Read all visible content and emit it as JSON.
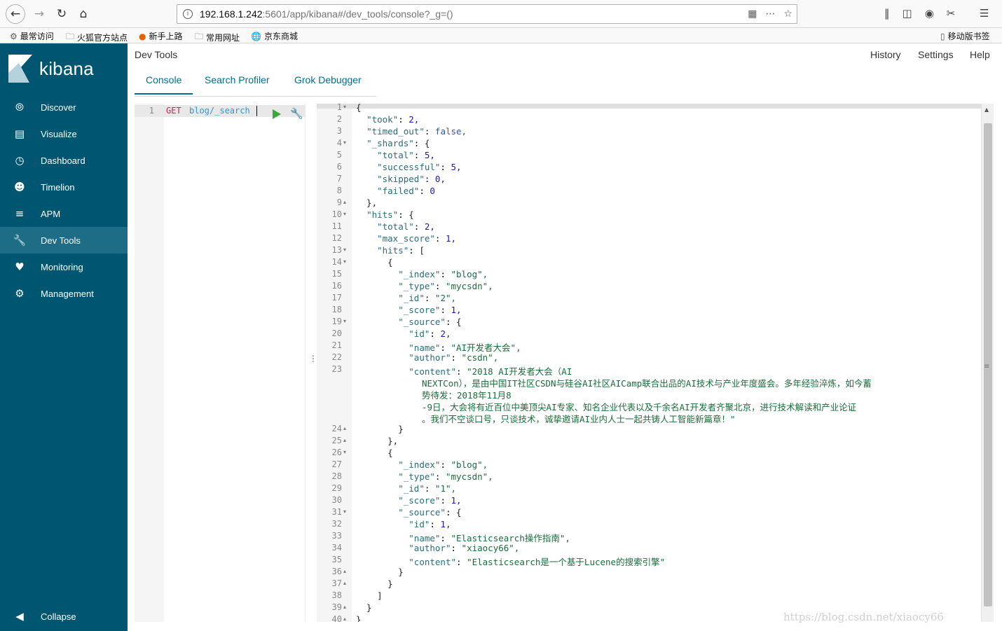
{
  "browser": {
    "url_host": "192.168.1.242",
    "url_path": ":5601/app/kibana#/dev_tools/console?_g=()",
    "bookmarks": [
      {
        "icon": "gear",
        "label": "最常访问"
      },
      {
        "icon": "folder",
        "label": "火狐官方站点"
      },
      {
        "icon": "firefox",
        "label": "新手上路"
      },
      {
        "icon": "folder",
        "label": "常用网址"
      },
      {
        "icon": "globe",
        "label": "京东商城"
      }
    ],
    "mobile_bookmarks": "移动版书签"
  },
  "sidebar": {
    "logo_text": "kibana",
    "items": [
      {
        "label": "Discover",
        "icon": "compass-icon"
      },
      {
        "label": "Visualize",
        "icon": "bar-chart-icon"
      },
      {
        "label": "Dashboard",
        "icon": "dashboard-icon"
      },
      {
        "label": "Timelion",
        "icon": "timelion-icon"
      },
      {
        "label": "APM",
        "icon": "apm-icon"
      },
      {
        "label": "Dev Tools",
        "icon": "wrench-icon",
        "active": true
      },
      {
        "label": "Monitoring",
        "icon": "heartbeat-icon"
      },
      {
        "label": "Management",
        "icon": "gear-icon"
      }
    ],
    "collapse_label": "Collapse"
  },
  "header": {
    "title": "Dev Tools",
    "links": [
      "History",
      "Settings",
      "Help"
    ],
    "tabs": [
      "Console",
      "Search Profiler",
      "Grok Debugger"
    ],
    "active_tab": "Console"
  },
  "editor": {
    "line_number": "1",
    "method": "GET",
    "url": "blog/_search"
  },
  "output_lines": [
    "{",
    "  \"took\": 2,",
    "  \"timed_out\": false,",
    "  \"_shards\": {",
    "    \"total\": 5,",
    "    \"successful\": 5,",
    "    \"skipped\": 0,",
    "    \"failed\": 0",
    "  },",
    "  \"hits\": {",
    "    \"total\": 2,",
    "    \"max_score\": 1,",
    "    \"hits\": [",
    "      {",
    "        \"_index\": \"blog\",",
    "        \"_type\": \"mycsdn\",",
    "        \"_id\": \"2\",",
    "        \"_score\": 1,",
    "        \"_source\": {",
    "          \"id\": 2,",
    "          \"name\": \"AI开发者大会\",",
    "          \"author\": \"csdn\",",
    "          \"content\": \"2018 AI开发者大会（AI",
    "        }",
    "      },",
    "      {",
    "        \"_index\": \"blog\",",
    "        \"_type\": \"mycsdn\",",
    "        \"_id\": \"1\",",
    "        \"_score\": 1,",
    "        \"_source\": {",
    "          \"id\": 1,",
    "          \"name\": \"Elasticsearch操作指南\",",
    "          \"author\": \"xiaocy66\",",
    "          \"content\": \"Elasticsearch是一个基于Lucene的搜索引擎\"",
    "        }",
    "      }",
    "    ]",
    "  }",
    "}"
  ],
  "content_wrap": [
    "NEXTCon），是由中国IT社区CSDN与硅谷AI社区AICamp联合出品的AI技术与产业年度盛会。多年经验淬炼，如今蓄",
    "势待发：2018年11月8",
    "-9日，大会将有近百位中美顶尖AI专家、知名企业代表以及千余名AI开发者齐聚北京，进行技术解读和产业论证",
    "。我们不空谈口号，只谈技术，诚挚邀请AI业内人士一起共铸人工智能新篇章！\""
  ],
  "watermark": "https://blog.csdn.net/xiaocy66"
}
